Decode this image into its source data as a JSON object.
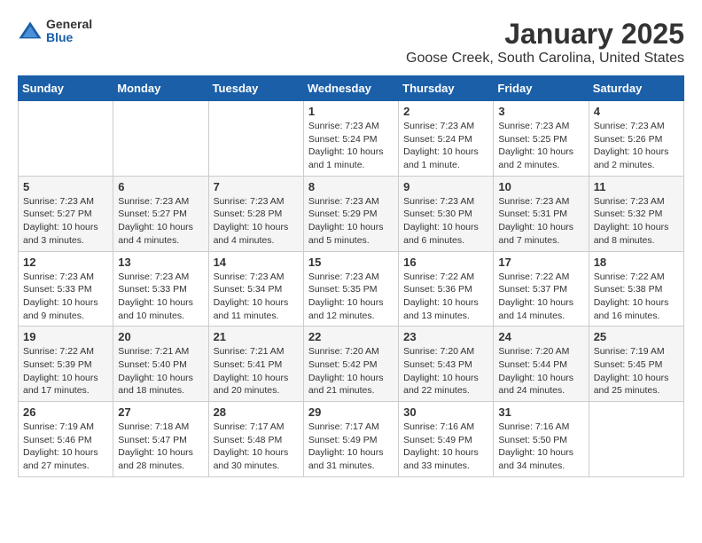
{
  "header": {
    "logo": {
      "general": "General",
      "blue": "Blue"
    },
    "title": "January 2025",
    "subtitle": "Goose Creek, South Carolina, United States"
  },
  "weekdays": [
    "Sunday",
    "Monday",
    "Tuesday",
    "Wednesday",
    "Thursday",
    "Friday",
    "Saturday"
  ],
  "weeks": [
    [
      {
        "day": "",
        "info": ""
      },
      {
        "day": "",
        "info": ""
      },
      {
        "day": "",
        "info": ""
      },
      {
        "day": "1",
        "info": "Sunrise: 7:23 AM\nSunset: 5:24 PM\nDaylight: 10 hours\nand 1 minute."
      },
      {
        "day": "2",
        "info": "Sunrise: 7:23 AM\nSunset: 5:24 PM\nDaylight: 10 hours\nand 1 minute."
      },
      {
        "day": "3",
        "info": "Sunrise: 7:23 AM\nSunset: 5:25 PM\nDaylight: 10 hours\nand 2 minutes."
      },
      {
        "day": "4",
        "info": "Sunrise: 7:23 AM\nSunset: 5:26 PM\nDaylight: 10 hours\nand 2 minutes."
      }
    ],
    [
      {
        "day": "5",
        "info": "Sunrise: 7:23 AM\nSunset: 5:27 PM\nDaylight: 10 hours\nand 3 minutes."
      },
      {
        "day": "6",
        "info": "Sunrise: 7:23 AM\nSunset: 5:27 PM\nDaylight: 10 hours\nand 4 minutes."
      },
      {
        "day": "7",
        "info": "Sunrise: 7:23 AM\nSunset: 5:28 PM\nDaylight: 10 hours\nand 4 minutes."
      },
      {
        "day": "8",
        "info": "Sunrise: 7:23 AM\nSunset: 5:29 PM\nDaylight: 10 hours\nand 5 minutes."
      },
      {
        "day": "9",
        "info": "Sunrise: 7:23 AM\nSunset: 5:30 PM\nDaylight: 10 hours\nand 6 minutes."
      },
      {
        "day": "10",
        "info": "Sunrise: 7:23 AM\nSunset: 5:31 PM\nDaylight: 10 hours\nand 7 minutes."
      },
      {
        "day": "11",
        "info": "Sunrise: 7:23 AM\nSunset: 5:32 PM\nDaylight: 10 hours\nand 8 minutes."
      }
    ],
    [
      {
        "day": "12",
        "info": "Sunrise: 7:23 AM\nSunset: 5:33 PM\nDaylight: 10 hours\nand 9 minutes."
      },
      {
        "day": "13",
        "info": "Sunrise: 7:23 AM\nSunset: 5:33 PM\nDaylight: 10 hours\nand 10 minutes."
      },
      {
        "day": "14",
        "info": "Sunrise: 7:23 AM\nSunset: 5:34 PM\nDaylight: 10 hours\nand 11 minutes."
      },
      {
        "day": "15",
        "info": "Sunrise: 7:23 AM\nSunset: 5:35 PM\nDaylight: 10 hours\nand 12 minutes."
      },
      {
        "day": "16",
        "info": "Sunrise: 7:22 AM\nSunset: 5:36 PM\nDaylight: 10 hours\nand 13 minutes."
      },
      {
        "day": "17",
        "info": "Sunrise: 7:22 AM\nSunset: 5:37 PM\nDaylight: 10 hours\nand 14 minutes."
      },
      {
        "day": "18",
        "info": "Sunrise: 7:22 AM\nSunset: 5:38 PM\nDaylight: 10 hours\nand 16 minutes."
      }
    ],
    [
      {
        "day": "19",
        "info": "Sunrise: 7:22 AM\nSunset: 5:39 PM\nDaylight: 10 hours\nand 17 minutes."
      },
      {
        "day": "20",
        "info": "Sunrise: 7:21 AM\nSunset: 5:40 PM\nDaylight: 10 hours\nand 18 minutes."
      },
      {
        "day": "21",
        "info": "Sunrise: 7:21 AM\nSunset: 5:41 PM\nDaylight: 10 hours\nand 20 minutes."
      },
      {
        "day": "22",
        "info": "Sunrise: 7:20 AM\nSunset: 5:42 PM\nDaylight: 10 hours\nand 21 minutes."
      },
      {
        "day": "23",
        "info": "Sunrise: 7:20 AM\nSunset: 5:43 PM\nDaylight: 10 hours\nand 22 minutes."
      },
      {
        "day": "24",
        "info": "Sunrise: 7:20 AM\nSunset: 5:44 PM\nDaylight: 10 hours\nand 24 minutes."
      },
      {
        "day": "25",
        "info": "Sunrise: 7:19 AM\nSunset: 5:45 PM\nDaylight: 10 hours\nand 25 minutes."
      }
    ],
    [
      {
        "day": "26",
        "info": "Sunrise: 7:19 AM\nSunset: 5:46 PM\nDaylight: 10 hours\nand 27 minutes."
      },
      {
        "day": "27",
        "info": "Sunrise: 7:18 AM\nSunset: 5:47 PM\nDaylight: 10 hours\nand 28 minutes."
      },
      {
        "day": "28",
        "info": "Sunrise: 7:17 AM\nSunset: 5:48 PM\nDaylight: 10 hours\nand 30 minutes."
      },
      {
        "day": "29",
        "info": "Sunrise: 7:17 AM\nSunset: 5:49 PM\nDaylight: 10 hours\nand 31 minutes."
      },
      {
        "day": "30",
        "info": "Sunrise: 7:16 AM\nSunset: 5:49 PM\nDaylight: 10 hours\nand 33 minutes."
      },
      {
        "day": "31",
        "info": "Sunrise: 7:16 AM\nSunset: 5:50 PM\nDaylight: 10 hours\nand 34 minutes."
      },
      {
        "day": "",
        "info": ""
      }
    ]
  ]
}
